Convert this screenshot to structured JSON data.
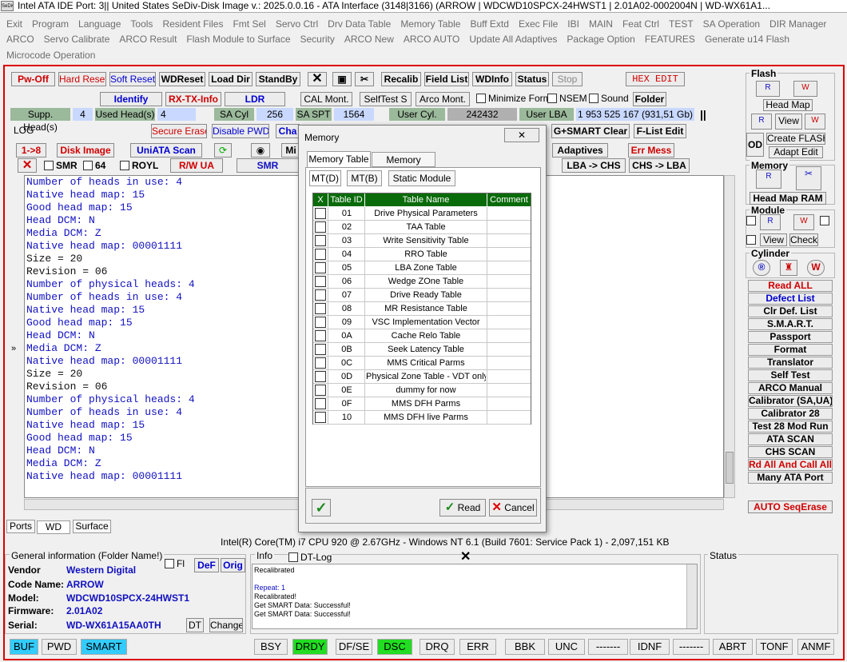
{
  "title": {
    "icon": "SeDiv",
    "text": "Intel ATA IDE  Port: 3|| United States  SeDiv-Disk Image v.: 2025.0.0.16 - ATA Interface (3148|3166)  (ARROW | WDCWD10SPCX-24HWST1 | 2.01A02-0002004N | WD-WX61A1..."
  },
  "menu": {
    "row1": [
      "Exit",
      "Program",
      "Language",
      "Tools",
      "Resident Files",
      "Fmt Sel",
      "Servo Ctrl",
      "Drv Data Table",
      "Memory Table",
      "Buff Extd",
      "Exec File",
      "IBI",
      "MAIN",
      "Feat Ctrl",
      "TEST",
      "SA Operation",
      "DIR Manager"
    ],
    "row2": [
      "ARCO",
      "Servo Calibrate",
      "ARCO Result",
      "Flash Module to Surface",
      "Security",
      "ARCO New",
      "ARCO AUTO",
      "Update All Adaptives",
      "Package Option",
      "FEATURES",
      "Generate u14 Flash"
    ],
    "row3": [
      "Microcode Operation"
    ]
  },
  "toolbar": {
    "pw_off": "Pw-Off",
    "hard_reset": "Hard Reset",
    "soft_reset": "Soft Reset",
    "wdreset": "WDReset",
    "load_dir": "Load Dir",
    "standby": "StandBy",
    "recalib": "Recalib",
    "field_list": "Field List",
    "wdinfo": "WDInfo",
    "status": "Status",
    "stop": "Stop",
    "hex_edit": "HEX EDIT",
    "identify": "Identify",
    "rx_tx_info": "RX-TX-Info",
    "ldr": "LDR",
    "cal_mont": "CAL Mont.",
    "selftest": "SelfTest S",
    "arco_mont": "Arco Mont.",
    "minimize_form": "Minimize Form",
    "nsem": "NSEM",
    "sound": "Sound",
    "folder": "Folder",
    "supp_heads_label": "Supp. Head(s)",
    "supp_heads": "4",
    "used_heads_label": "Used Head(s)",
    "used_heads": "4",
    "sa_cyl_label": "SA Cyl",
    "sa_cyl": "256",
    "sa_spt_label": "SA SPT",
    "sa_spt": "1564",
    "user_cyl_label": "User Cyl.",
    "user_cyl": "242432",
    "user_lba_label": "User LBA",
    "user_lba": "1 953 525 167  (931,51 Gb)",
    "log_label": "LOG",
    "secure_erase": "Secure Erase",
    "disable_pwd": "Disable PWD",
    "cha": "Cha",
    "gsmart_clear": "G+SMART Clear",
    "flist_edit": "F-List Edit",
    "one_to_eight": "1->8",
    "disk_image": "Disk Image",
    "uniata_scan": "UniATA Scan",
    "mi": "Mi",
    "adaptives": "Adaptives",
    "err_mess": "Err Mess",
    "smr": "SMR",
    "sixtyfour": "64",
    "royl": "ROYL",
    "rw_ua": "R/W UA",
    "smr2": "SMR",
    "lba_chs": "LBA -> CHS",
    "chs_lba": "CHS -> LBA",
    "expand": "»"
  },
  "log_lines": [
    {
      "t": "Number of heads in use: 4",
      "c": "blue"
    },
    {
      "t": "Native head map: 15",
      "c": "blue"
    },
    {
      "t": "Good head map: 15",
      "c": "blue"
    },
    {
      "t": "Head DCM: N",
      "c": "blue"
    },
    {
      "t": "Media DCM: Z",
      "c": "blue"
    },
    {
      "t": "Native head map: 00001111",
      "c": "blue"
    },
    {
      "t": "Size = 20",
      "c": "blk"
    },
    {
      "t": "Revision = 06",
      "c": "blk"
    },
    {
      "t": "Number of physical heads: 4",
      "c": "blue"
    },
    {
      "t": "Number of heads in use: 4",
      "c": "blue"
    },
    {
      "t": "Native head map: 15",
      "c": "blue"
    },
    {
      "t": "Good head map: 15",
      "c": "blue"
    },
    {
      "t": "Head DCM: N",
      "c": "blue"
    },
    {
      "t": "Media DCM: Z",
      "c": "blue"
    },
    {
      "t": "Native head map: 00001111",
      "c": "blue"
    },
    {
      "t": "Size = 20",
      "c": "blk"
    },
    {
      "t": "Revision = 06",
      "c": "blk"
    },
    {
      "t": "Number of physical heads: 4",
      "c": "blue"
    },
    {
      "t": "Number of heads in use: 4",
      "c": "blue"
    },
    {
      "t": "Native head map: 15",
      "c": "blue"
    },
    {
      "t": "Good head map: 15",
      "c": "blue"
    },
    {
      "t": "Head DCM: N",
      "c": "blue"
    },
    {
      "t": "Media DCM: Z",
      "c": "blue"
    },
    {
      "t": "Native head map: 00001111",
      "c": "blue"
    }
  ],
  "right": {
    "flash": "Flash",
    "head_map": "Head Map",
    "view": "View",
    "create_flash": "Create FLASH",
    "adapt_edit": "Adapt Edit",
    "od": "OD",
    "memory": "Memory",
    "head_map_ram": "Head Map RAM",
    "module": "Module",
    "view2": "View",
    "check": "Check",
    "cylinder": "Cylinder",
    "buttons": [
      {
        "label": "Read ALL",
        "color": "red"
      },
      {
        "label": "Defect List",
        "color": "blue"
      },
      {
        "label": "Clr Def. List",
        "color": "blk"
      },
      {
        "label": "S.M.A.R.T.",
        "color": "blk"
      },
      {
        "label": "Passport",
        "color": "blk"
      },
      {
        "label": "Format",
        "color": "blk"
      },
      {
        "label": "Translator",
        "color": "blk"
      },
      {
        "label": "Self Test",
        "color": "blk"
      },
      {
        "label": "ARCO Manual",
        "color": "blk"
      },
      {
        "label": "Calibrator (SA,UA)",
        "color": "blk"
      },
      {
        "label": "Calibrator 28",
        "color": "blk"
      },
      {
        "label": "Test 28 Mod Run",
        "color": "blk"
      },
      {
        "label": "ATA SCAN",
        "color": "blk"
      },
      {
        "label": "CHS SCAN",
        "color": "blk"
      },
      {
        "label": "Rd All And Call All",
        "color": "red"
      },
      {
        "label": "Many ATA Port",
        "color": "blk"
      }
    ],
    "auto_seq_erase": "AUTO SeqErase",
    "dr_labels": [
      "R",
      "W",
      "R",
      "W",
      "R",
      "W",
      "R",
      "W"
    ]
  },
  "modal": {
    "title": "Memory",
    "tabs": [
      "Memory Table",
      "Memory Range"
    ],
    "subtabs": [
      "MT(D)",
      "MT(B)",
      "Static Module"
    ],
    "headers": [
      "X",
      "Table ID",
      "Table Name",
      "Comment"
    ],
    "rows": [
      {
        "id": "01",
        "name": "Drive Physical Parameters"
      },
      {
        "id": "02",
        "name": "TAA Table"
      },
      {
        "id": "03",
        "name": "Write Sensitivity Table"
      },
      {
        "id": "04",
        "name": "RRO Table"
      },
      {
        "id": "05",
        "name": "LBA Zone Table"
      },
      {
        "id": "06",
        "name": "Wedge ZOne Table"
      },
      {
        "id": "07",
        "name": "Drive Ready Table"
      },
      {
        "id": "08",
        "name": "MR Resistance Table"
      },
      {
        "id": "09",
        "name": "VSC Implementation Vector"
      },
      {
        "id": "0A",
        "name": "Cache Relo Table"
      },
      {
        "id": "0B",
        "name": "Seek Latency Table"
      },
      {
        "id": "0C",
        "name": "MMS Critical Parms"
      },
      {
        "id": "0D",
        "name": "Physical Zone Table - VDT only"
      },
      {
        "id": "0E",
        "name": "dummy for now"
      },
      {
        "id": "0F",
        "name": "MMS DFH Parms"
      },
      {
        "id": "10",
        "name": "MMS DFH live Parms"
      }
    ],
    "read": "Read",
    "cancel": "Cancel"
  },
  "bottom_tabs": [
    "Ports",
    "WD",
    "Surface"
  ],
  "cpu_info": "Intel(R) Core(TM) i7 CPU 920  @ 2.67GHz - Windows NT 6.1 (Build 7601: Service Pack 1) -  2,097,151 KB",
  "general": {
    "title": "General information (Folder Name!)",
    "fl": "Fl",
    "def": "DeF",
    "orig": "Orig",
    "vendor_label": "Vendor",
    "vendor": "Western Digital",
    "code_label": "Code Name:",
    "code": "ARROW",
    "model_label": "Model:",
    "model": "WDCWD10SPCX-24HWST1",
    "fw_label": "Firmware:",
    "fw": "2.01A02",
    "serial_label": "Serial:",
    "serial": "WD-WX61A15AA0TH",
    "dt": "DT",
    "change": "Change"
  },
  "info": {
    "title": "Info",
    "dtlog": "DT-Log",
    "lines": [
      "Recalibrated",
      "",
      "Repeat: 1",
      "Recalibrated!",
      "Get SMART Data: Successful!",
      "Get SMART Data: Successful!"
    ]
  },
  "status_title": "Status",
  "status_bar": [
    {
      "t": "BUF",
      "on": "cyan"
    },
    {
      "t": "PWD",
      "on": ""
    },
    {
      "t": "SMART",
      "on": "cyan"
    },
    {
      "t": "BSY",
      "on": ""
    },
    {
      "t": "DRDY",
      "on": "green"
    },
    {
      "t": "DF/SE",
      "on": ""
    },
    {
      "t": "DSC",
      "on": "green"
    },
    {
      "t": "DRQ",
      "on": ""
    },
    {
      "t": "ERR",
      "on": ""
    },
    {
      "t": "BBK",
      "on": ""
    },
    {
      "t": "UNC",
      "on": ""
    },
    {
      "t": "-------",
      "on": ""
    },
    {
      "t": "IDNF",
      "on": ""
    },
    {
      "t": "-------",
      "on": ""
    },
    {
      "t": "ABRT",
      "on": ""
    },
    {
      "t": "TONF",
      "on": ""
    },
    {
      "t": "ANMF",
      "on": ""
    }
  ],
  "colors": {
    "frame": "#dd0000",
    "accent_blue": "#4040ff",
    "table_header": "#0a6b0a",
    "cyan": "#33ccff",
    "green": "#22dd22"
  }
}
